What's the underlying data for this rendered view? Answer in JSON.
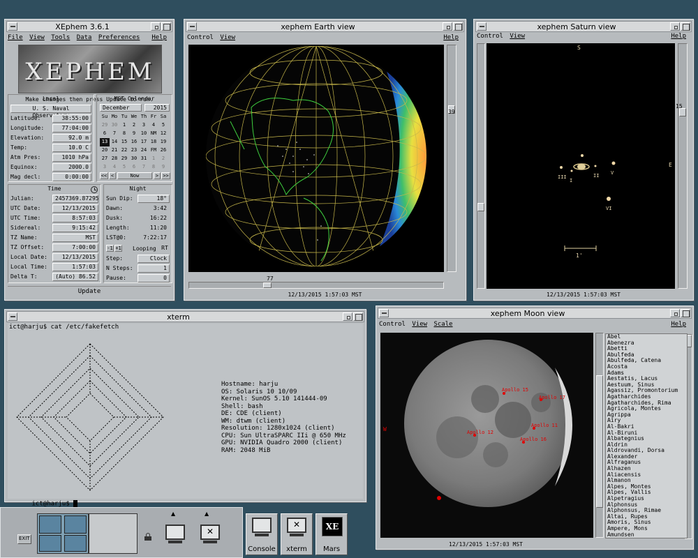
{
  "xephem": {
    "title": "XEphem 3.6.1",
    "menu": [
      "File",
      "View",
      "Tools",
      "Data",
      "Preferences"
    ],
    "help": "Help",
    "logo_text": "XEPHEM",
    "message": "Make changes then press Update to run.",
    "local": {
      "header": "Local",
      "location": "U. S. Naval Observatory",
      "rows": [
        {
          "k": "Latitude:",
          "v": "38:55:00"
        },
        {
          "k": "Longitude:",
          "v": "77:04:00"
        },
        {
          "k": "Elevation:",
          "v": "92.0 m"
        },
        {
          "k": "Temp:",
          "v": "10.0 C"
        },
        {
          "k": "Atm Pres:",
          "v": "1010 hPa"
        },
        {
          "k": "Equinox:",
          "v": "2000.0"
        },
        {
          "k": "Mag decl:",
          "v": "0:00:00"
        }
      ]
    },
    "calendar": {
      "header": "MST Calendar",
      "month": "December",
      "year": "2015",
      "weekdays": [
        "Su",
        "Mo",
        "Tu",
        "We",
        "Th",
        "Fr",
        "Sa"
      ],
      "weeks": [
        [
          "29",
          "30",
          "1",
          "2",
          "3",
          "4",
          "5"
        ],
        [
          "6",
          "7",
          "8",
          "9",
          "10",
          "NM",
          "12"
        ],
        [
          "13",
          "14",
          "15",
          "16",
          "17",
          "18",
          "19"
        ],
        [
          "20",
          "21",
          "22",
          "23",
          "24",
          "FM",
          "26"
        ],
        [
          "27",
          "28",
          "29",
          "30",
          "31",
          "1",
          "2"
        ],
        [
          "3",
          "4",
          "5",
          "6",
          "7",
          "8",
          "9"
        ]
      ],
      "prev": "<<",
      "prev1": "<",
      "now": "Now",
      "next1": ">",
      "next": ">>"
    },
    "time": {
      "header": "Time",
      "rows": [
        {
          "k": "Julian:",
          "v": "2457369.87295"
        },
        {
          "k": "UTC Date:",
          "v": "12/13/2015"
        },
        {
          "k": "UTC Time:",
          "v": "8:57:03"
        },
        {
          "k": "Sidereal:",
          "v": "9:15:42"
        },
        {
          "k": "TZ Name:",
          "v": "MST"
        },
        {
          "k": "TZ Offset:",
          "v": "7:00:00"
        },
        {
          "k": "Local Date:",
          "v": "12/13/2015"
        },
        {
          "k": "Local Time:",
          "v": "1:57:03"
        },
        {
          "k": "Delta T:",
          "v": "(Auto)  86.52"
        }
      ]
    },
    "night": {
      "header": "Night",
      "rows": [
        {
          "k": "Sun Dip:",
          "v": "18°"
        },
        {
          "k": "Dawn:",
          "v": "3:42"
        },
        {
          "k": "Dusk:",
          "v": "16:22"
        },
        {
          "k": "Length:",
          "v": "11:20"
        },
        {
          "k": "LST@0:",
          "v": "7:22:17"
        }
      ],
      "loop_minus": "-1",
      "loop_plus": "+1",
      "looping": "Looping",
      "rt": "RT",
      "step_k": "Step:",
      "step_v": "Clock",
      "nsteps_k": "N Steps:",
      "nsteps_v": "1",
      "pause_k": "Pause:",
      "pause_v": "0"
    },
    "update": "Update"
  },
  "earth": {
    "title": "xephem Earth view",
    "menu": [
      "Control",
      "View"
    ],
    "help": "Help",
    "lat_value": "39",
    "lon_value": "77",
    "status": "12/13/2015   1:57:03 MST"
  },
  "saturn": {
    "title": "xephem Saturn view",
    "menu": [
      "Control",
      "View"
    ],
    "help": "Help",
    "scale_value": "15",
    "south": "S",
    "east": "E",
    "moon_labels": [
      "III",
      "I",
      "II",
      "V",
      "VI"
    ],
    "scale_label": "1'",
    "status": "12/13/2015   1:57:03 MST"
  },
  "xterm": {
    "title": "xterm",
    "prompt1": "ict@harju$ cat /etc/fakefetch",
    "info": [
      "Hostname: harju",
      "OS: Solaris 10 10/09",
      "Kernel: SunOS 5.10 141444-09",
      "Shell: bash",
      "DE: CDE (client)",
      "WM: dtwm (client)",
      "Resolution: 1280x1024 (client)",
      "CPU: Sun UltraSPARC IIi @ 650 MHz",
      "GPU: NVIDIA Quadro 2000 (client)",
      "RAM: 2048 MiB"
    ],
    "prompt2": "ict@harju$ "
  },
  "moon": {
    "title": "xephem Moon view",
    "menu": [
      "Control",
      "View",
      "Scale"
    ],
    "help": "Help",
    "west": "W",
    "apollo": [
      "Apollo 15",
      "Apollo 17",
      "Apollo 11",
      "Apollo 12",
      "Apollo 16"
    ],
    "status": "12/13/2015   1:57:03 MST",
    "features": [
      "Abel",
      "Abenezra",
      "Abetti",
      "Abulfeda",
      "Abulfeda, Catena",
      "Acosta",
      "Adams",
      "Aestatis, Lacus",
      "Aestuum, Sinus",
      "Agassiz, Promontorium",
      "Agatharchides",
      "Agatharchides, Rima",
      "Agricola, Montes",
      "Agrippa",
      "Airy",
      "Al-Bakri",
      "Al-Biruni",
      "Albategnius",
      "Aldrin",
      "Aldrovandi, Dorsa",
      "Alexander",
      "Alfraganus",
      "Alhazen",
      "Aliacensis",
      "Almanon",
      "Alpes, Montes",
      "Alpes, Vallis",
      "Alpetragius",
      "Alphonsus",
      "Alphonsus, Rimae",
      "Altai, Rupes",
      "Amoris, Sinus",
      "Ampere, Mons",
      "Amundsen"
    ]
  },
  "frontpanel": {
    "exit": "EXIT",
    "console": "Console",
    "xterm": "xterm",
    "mars": "Mars",
    "mars_icon": "XE"
  }
}
